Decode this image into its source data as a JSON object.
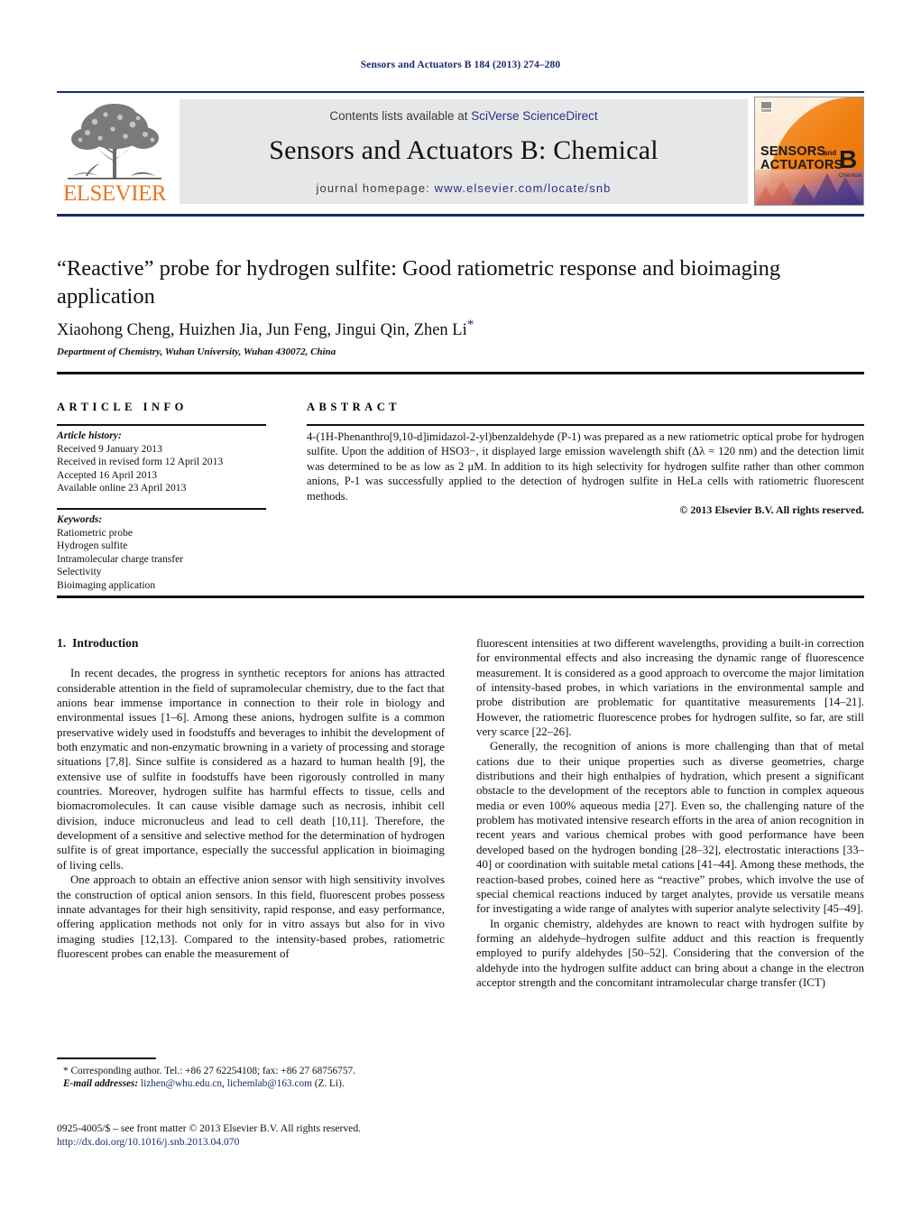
{
  "running_head": "Sensors and Actuators B 184 (2013) 274–280",
  "masthead": {
    "publisher_name": "ELSEVIER",
    "contents_prefix": "Contents lists available at ",
    "contents_link": "SciVerse ScienceDirect",
    "journal_title": "Sensors and Actuators B: Chemical",
    "homepage_prefix": "journal homepage: ",
    "homepage_url": "www.elsevier.com/locate/snb",
    "cover": {
      "line1": "SENSORS",
      "line1_small": "and",
      "line2": "ACTUATORS",
      "letter": "B",
      "letter_sub": "Chemical"
    },
    "colors": {
      "rule": "#1a2a6c",
      "band": "#e6e7e9",
      "link": "#2b2f87",
      "elsevier_orange": "#E87722"
    }
  },
  "article": {
    "title": "“Reactive” probe for hydrogen sulfite: Good ratiometric response and bioimaging application",
    "authors": "Xiaohong Cheng, Huizhen Jia, Jun Feng, Jingui Qin, Zhen Li",
    "corresponding_marker": "*",
    "affiliation": "Department of Chemistry, Wuhan University, Wuhan 430072, China"
  },
  "info": {
    "heading": "ARTICLE INFO",
    "history_label": "Article history:",
    "history": [
      "Received 9 January 2013",
      "Received in revised form 12 April 2013",
      "Accepted 16 April 2013",
      "Available online 23 April 2013"
    ],
    "keywords_label": "Keywords:",
    "keywords": [
      "Ratiometric probe",
      "Hydrogen sulfite",
      "Intramolecular charge transfer",
      "Selectivity",
      "Bioimaging application"
    ]
  },
  "abstract": {
    "heading": "ABSTRACT",
    "text": "4-(1H-Phenanthro[9,10-d]imidazol-2-yl)benzaldehyde (P-1) was prepared as a new ratiometric optical probe for hydrogen sulfite. Upon the addition of HSO3−, it displayed large emission wavelength shift (Δλ = 120 nm) and the detection limit was determined to be as low as 2 μM. In addition to its high selectivity for hydrogen sulfite rather than other common anions, P-1 was successfully applied to the detection of hydrogen sulfite in HeLa cells with ratiometric fluorescent methods.",
    "copyright": "© 2013 Elsevier B.V. All rights reserved."
  },
  "body": {
    "section_number": "1.",
    "section_title": "Introduction",
    "left_paragraphs": [
      "In recent decades, the progress in synthetic receptors for anions has attracted considerable attention in the field of supramolecular chemistry, due to the fact that anions bear immense importance in connection to their role in biology and environmental issues [1–6]. Among these anions, hydrogen sulfite is a common preservative widely used in foodstuffs and beverages to inhibit the development of both enzymatic and non-enzymatic browning in a variety of processing and storage situations [7,8]. Since sulfite is considered as a hazard to human health [9], the extensive use of sulfite in foodstuffs have been rigorously controlled in many countries. Moreover, hydrogen sulfite has harmful effects to tissue, cells and biomacromolecules. It can cause visible damage such as necrosis, inhibit cell division, induce micronucleus and lead to cell death [10,11]. Therefore, the development of a sensitive and selective method for the determination of hydrogen sulfite is of great importance, especially the successful application in bioimaging of living cells.",
      "One approach to obtain an effective anion sensor with high sensitivity involves the construction of optical anion sensors. In this field, fluorescent probes possess innate advantages for their high sensitivity, rapid response, and easy performance, offering application methods not only for in vitro assays but also for in vivo imaging studies [12,13]. Compared to the intensity-based probes, ratiometric fluorescent probes can enable the measurement of"
    ],
    "right_paragraphs": [
      "fluorescent intensities at two different wavelengths, providing a built-in correction for environmental effects and also increasing the dynamic range of fluorescence measurement. It is considered as a good approach to overcome the major limitation of intensity-based probes, in which variations in the environmental sample and probe distribution are problematic for quantitative measurements [14–21]. However, the ratiometric fluorescence probes for hydrogen sulfite, so far, are still very scarce [22–26].",
      "Generally, the recognition of anions is more challenging than that of metal cations due to their unique properties such as diverse geometries, charge distributions and their high enthalpies of hydration, which present a significant obstacle to the development of the receptors able to function in complex aqueous media or even 100% aqueous media [27]. Even so, the challenging nature of the problem has motivated intensive research efforts in the area of anion recognition in recent years and various chemical probes with good performance have been developed based on the hydrogen bonding [28–32], electrostatic interactions [33–40] or coordination with suitable metal cations [41–44]. Among these methods, the reaction-based probes, coined here as “reactive” probes, which involve the use of special chemical reactions induced by target analytes, provide us versatile means for investigating a wide range of analytes with superior analyte selectivity [45–49].",
      "In organic chemistry, aldehydes are known to react with hydrogen sulfite by forming an aldehyde–hydrogen sulfite adduct and this reaction is frequently employed to purify aldehydes [50–52]. Considering that the conversion of the aldehyde into the hydrogen sulfite adduct can bring about a change in the electron acceptor strength and the concomitant intramolecular charge transfer (ICT)"
    ]
  },
  "footnotes": {
    "corresponding": "* Corresponding author. Tel.: +86 27 62254108; fax: +86 27 68756757.",
    "email_label": "E-mail addresses:",
    "email_1": "lizhen@whu.edu.cn",
    "email_sep": ", ",
    "email_2": "lichemlab@163.com",
    "email_suffix": " (Z. Li)."
  },
  "imprint": {
    "issn_line": "0925-4005/$ – see front matter © 2013 Elsevier B.V. All rights reserved.",
    "doi": "http://dx.doi.org/10.1016/j.snb.2013.04.070"
  }
}
